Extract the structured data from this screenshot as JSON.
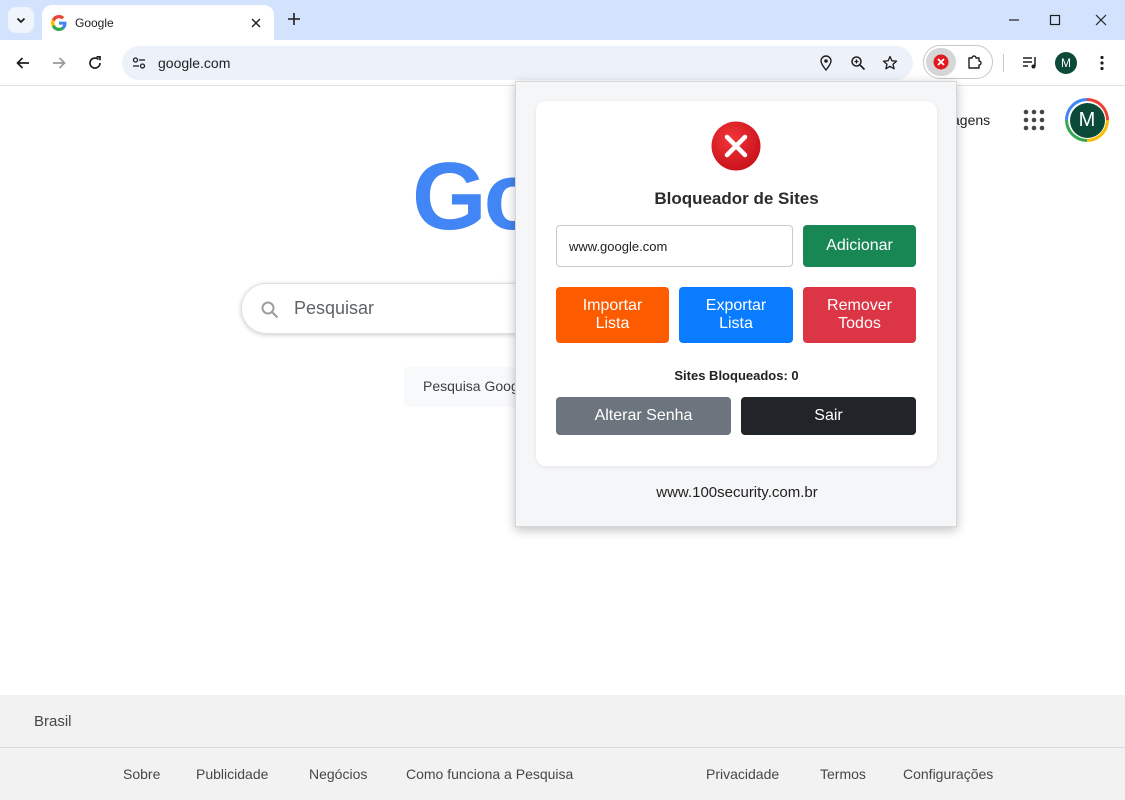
{
  "browser": {
    "tab": {
      "title": "Google"
    },
    "address_bar": {
      "url": "google.com"
    },
    "profile_initial": "M",
    "colors": {
      "tabstrip": "#d3e3fd",
      "omnibox": "#edf2fa"
    }
  },
  "google": {
    "logo_text": "Go",
    "header": {
      "images_link": "agens",
      "avatar_initial": "M"
    },
    "search": {
      "placeholder": "Pesquisar",
      "button": "Pesquisa Google"
    },
    "footer": {
      "country": "Brasil",
      "links_left": [
        "Sobre",
        "Publicidade",
        "Negócios",
        "Como funciona a Pesquisa"
      ],
      "links_right": [
        "Privacidade",
        "Termos",
        "Configurações"
      ]
    }
  },
  "extension": {
    "title": "Bloqueador de Sites",
    "input_value": "www.google.com",
    "buttons": {
      "add": "Adicionar",
      "import": "Importar Lista",
      "export": "Exportar Lista",
      "remove_all": "Remover Todos",
      "change_password": "Alterar Senha",
      "exit": "Sair"
    },
    "blocked_label": "Sites Bloqueados: 0",
    "footer_url": "www.100security.com.br",
    "colors": {
      "add": "#198754",
      "import": "#fd5b00",
      "export": "#0a7cff",
      "remove": "#dc3545",
      "password": "#6c757d",
      "exit": "#212529",
      "logo_red": "#e0191f"
    }
  }
}
